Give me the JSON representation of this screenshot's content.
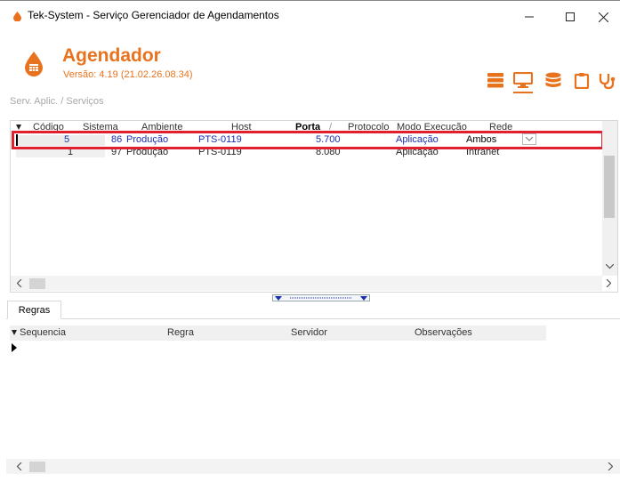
{
  "window": {
    "title": "Tek-System - Serviço Gerenciador de Agendamentos",
    "minimize_glyph": "—",
    "maximize_glyph": "☐",
    "close_glyph": "✕"
  },
  "header": {
    "app_name": "Agendador",
    "version": "Versão: 4.19 (21.02.26.08.34)",
    "brand_color": "#e8731e",
    "icons": [
      "server-icon",
      "monitor-icon",
      "database-icon",
      "clipboard-icon",
      "stethoscope-icon"
    ]
  },
  "breadcrumb": "Serv. Aplic. / Serviços",
  "services_grid": {
    "columns": [
      "Código",
      "Sistema",
      "Ambiente",
      "Host",
      "Porta",
      "Protocolo",
      "Modo Execução",
      "Rede"
    ],
    "sort_separator": "/",
    "rows": [
      {
        "codigo": "5",
        "sistema": "86",
        "ambiente": "Produção",
        "host": "PTS-0119",
        "porta": "5.700",
        "protocolo": "",
        "modo": "Aplicação",
        "rede": "Ambos"
      },
      {
        "codigo": "1",
        "sistema": "97",
        "ambiente": "Produção",
        "host": "PTS-0119",
        "porta": "8.080",
        "protocolo": "",
        "modo": "Aplicação",
        "rede": "Intranet"
      }
    ],
    "selected_row": 0
  },
  "tabs": {
    "active": "Regras"
  },
  "rules_grid": {
    "columns": [
      "Sequencia",
      "Regra",
      "Servidor",
      "Observações"
    ]
  }
}
